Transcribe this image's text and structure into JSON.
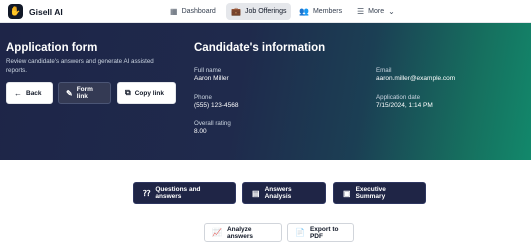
{
  "nav": {
    "brand": "Gisell AI",
    "items": [
      {
        "label": "Dashboard",
        "icon": "grid-icon"
      },
      {
        "label": "Job Offerings",
        "icon": "briefcase-icon",
        "active": true
      },
      {
        "label": "Members",
        "icon": "users-icon"
      },
      {
        "label": "More",
        "icon": "menu-icon"
      }
    ]
  },
  "application": {
    "title": "Application form",
    "description": "Review candidate's answers and generate AI assisted reports.",
    "back_label": "Back",
    "form_link_label": "Form link",
    "copy_link_label": "Copy link"
  },
  "candidate": {
    "title": "Candidate's information",
    "full_name_label": "Full name",
    "full_name": "Aaron Miller",
    "phone_label": "Phone",
    "phone": "(555) 123-4568",
    "rating_label": "Overall rating",
    "rating": "8.00",
    "email_label": "Email",
    "email": "aaron.miller@example.com",
    "date_label": "Application date",
    "date": "7/15/2024, 1:14 PM"
  },
  "tabs": {
    "questions": "Questions and answers",
    "analysis": "Answers Analysis",
    "summary": "Executive Summary"
  },
  "actions": {
    "analyze": "Analyze answers",
    "export": "Export to PDF"
  },
  "colors": {
    "hero_start": "#1e2548",
    "hero_end": "#12886b",
    "tab_bg": "#1f2546"
  }
}
